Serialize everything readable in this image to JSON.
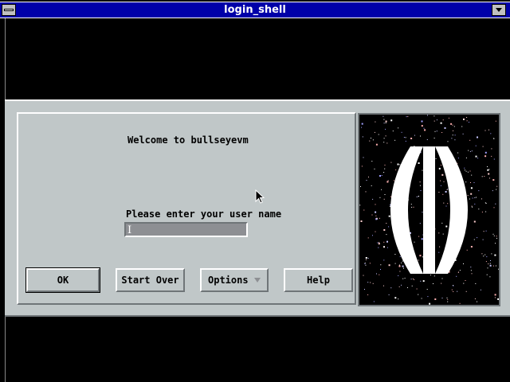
{
  "window": {
    "title": "login_shell"
  },
  "dialog": {
    "welcome_text": "Welcome to bullseyevm",
    "prompt_text": "Please enter your user name",
    "username_value": "",
    "buttons": {
      "ok": "OK",
      "start_over": "Start Over",
      "options": "Options",
      "help": "Help"
    }
  },
  "colors": {
    "titlebar": "#0000a8",
    "dialog_bg": "#c0c7c8",
    "input_bg": "#8d8f93"
  },
  "icons": {
    "system_menu": "system-menu-icon",
    "minimize": "minimize-arrow-icon",
    "logo": "bullseye-logo",
    "cursor": "mouse-pointer-icon"
  }
}
